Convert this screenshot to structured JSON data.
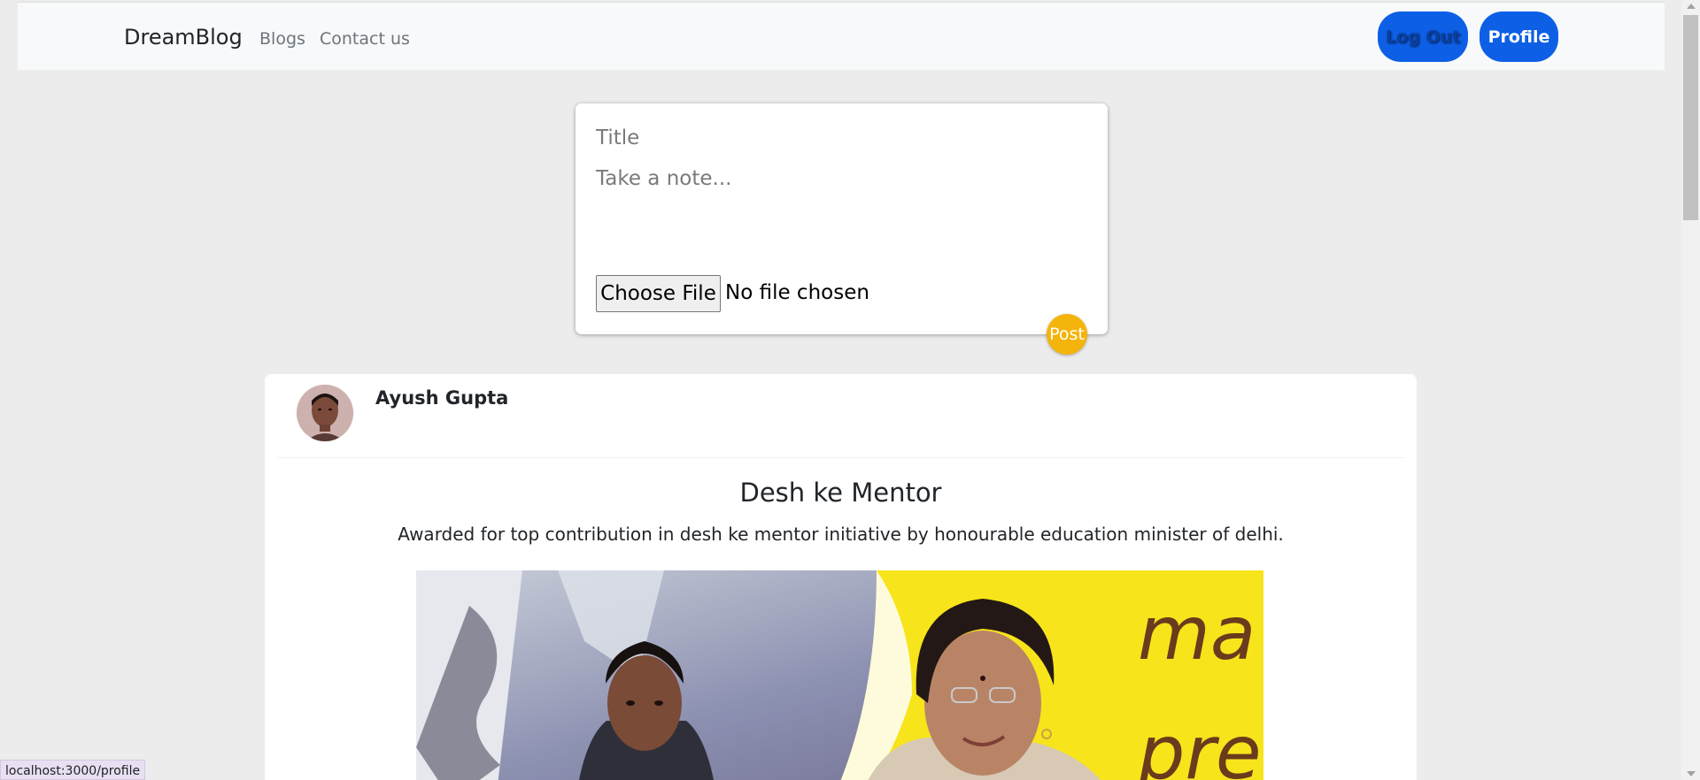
{
  "navbar": {
    "brand": "DreamBlog",
    "links": [
      "Blogs",
      "Contact us"
    ],
    "logout_label": "Log Out",
    "profile_label": "Profile"
  },
  "compose": {
    "title_placeholder": "Title",
    "note_placeholder": "Take a note...",
    "choose_file_label": "Choose File",
    "file_status": "No file chosen",
    "post_label": "Post"
  },
  "post": {
    "author": "Ayush Gupta",
    "title": "Desh ke Mentor",
    "description": "Awarded for top contribution in desh ke mentor initiative by honourable education minister of delhi.",
    "image_text": "ma pre"
  },
  "status_bar": {
    "url": "localhost:3000/profile"
  },
  "colors": {
    "primary_button": "#0d5fe6",
    "post_button": "#f5b40b",
    "background": "#ececec"
  }
}
